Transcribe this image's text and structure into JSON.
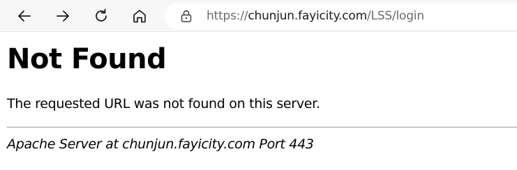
{
  "browser": {
    "url": {
      "scheme": "https://",
      "host": "chunjun.fayicity.com",
      "path": "/LSS/login"
    },
    "icons": {
      "back": "arrow-left-icon",
      "forward": "arrow-right-icon",
      "refresh": "refresh-icon",
      "home": "home-icon",
      "site_info": "lock-icon"
    }
  },
  "page": {
    "heading": "Not Found",
    "message": "The requested URL was not found on this server.",
    "server_signature": "Apache Server at chunjun.fayicity.com Port 443"
  }
}
